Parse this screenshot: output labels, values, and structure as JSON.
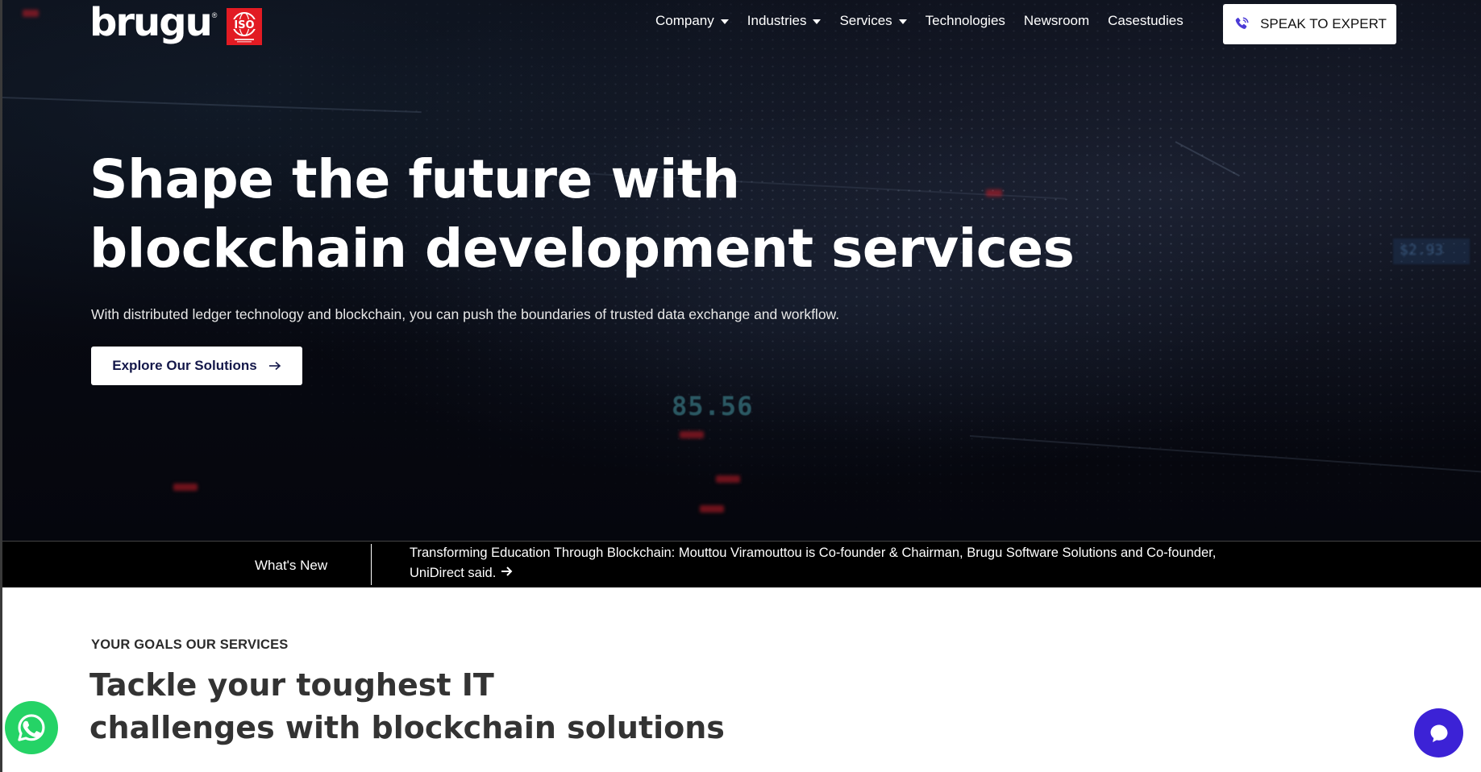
{
  "brand": {
    "logo_text": "brugu",
    "registered_mark": "®",
    "badge_text": "ISO",
    "badge_color": "#e21b23"
  },
  "nav": {
    "items": [
      {
        "label": "Company",
        "has_dropdown": true
      },
      {
        "label": "Industries",
        "has_dropdown": true
      },
      {
        "label": "Services",
        "has_dropdown": true
      },
      {
        "label": "Technologies",
        "has_dropdown": false
      },
      {
        "label": "Newsroom",
        "has_dropdown": false
      },
      {
        "label": "Casestudies",
        "has_dropdown": false
      }
    ],
    "cta_label": "SPEAK TO EXPERT",
    "cta_icon": "phone-icon"
  },
  "hero": {
    "title_line1": "Shape the future with",
    "title_line2": "blockchain development services",
    "subtitle": "With distributed ledger technology and blockchain, you can push the boundaries of trusted data exchange and workflow.",
    "button_label": "Explore Our Solutions",
    "button_icon": "arrow-right-icon",
    "background_number": "85.56",
    "background_box": "$2.93"
  },
  "news": {
    "label": "What's New",
    "headline": "Transforming Education Through Blockchain: Mouttou Viramouttou is Co-founder & Chairman, Brugu Software Solutions and Co-founder, UniDirect said."
  },
  "services": {
    "eyebrow": "YOUR GOALS OUR SERVICES",
    "title_line1": "Tackle your toughest IT",
    "title_line2": "challenges with blockchain solutions"
  },
  "floating": {
    "whatsapp_icon": "whatsapp-icon",
    "chat_icon": "chat-bubble-icon",
    "whatsapp_color": "#25d366",
    "chat_color": "#3c22d6"
  },
  "colors": {
    "hero_bg": "#070911",
    "button_text": "#14184a",
    "heading_dark": "#333333"
  }
}
